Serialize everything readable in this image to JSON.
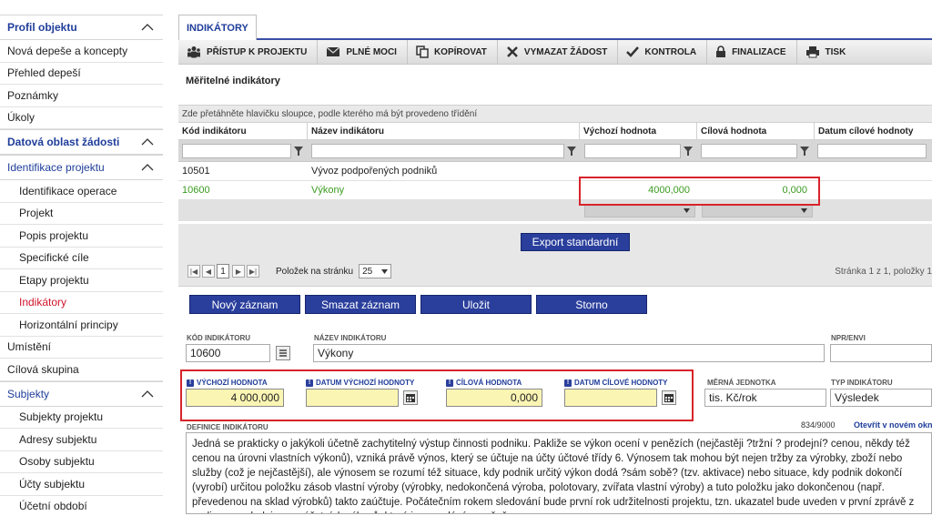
{
  "sidebar": {
    "sections": [
      {
        "title": "Profil objektu",
        "items": [
          "Nová depeše a koncepty",
          "Přehled depeší",
          "Poznámky",
          "Úkoly"
        ]
      },
      {
        "title": "Datová oblast žádosti"
      },
      {
        "title": "Identifikace projektu",
        "items": [
          "Identifikace operace",
          "Projekt",
          "Popis projektu",
          "Specifické cíle",
          "Etapy projektu",
          "Indikátory",
          "Horizontální principy"
        ]
      }
    ],
    "after": [
      "Umístění",
      "Cílová skupina"
    ],
    "subjekty": {
      "title": "Subjekty",
      "items": [
        "Subjekty projektu",
        "Adresy subjektu",
        "Osoby subjektu",
        "Účty subjektu",
        "Účetní období"
      ]
    },
    "active": "Indikátory"
  },
  "tab": "INDIKÁTORY",
  "toolbar": {
    "items": [
      {
        "label": "PŘÍSTUP K PROJEKTU",
        "icon": "users-icon"
      },
      {
        "label": "PLNÉ MOCI",
        "icon": "envelope-icon"
      },
      {
        "label": "KOPÍROVAT",
        "icon": "copy-icon"
      },
      {
        "label": "VYMAZAT ŽÁDOST",
        "icon": "x-icon"
      },
      {
        "label": "KONTROLA",
        "icon": "check-icon"
      },
      {
        "label": "FINALIZACE",
        "icon": "lock-icon"
      },
      {
        "label": "TISK",
        "icon": "printer-icon"
      }
    ]
  },
  "section_title": "Měřitelné indikátory",
  "grid": {
    "drag_hint": "Zde přetáhněte hlavičku sloupce, podle kterého má být provedeno třídění",
    "columns": [
      "Kód indikátoru",
      "Název indikátoru",
      "Výchozí hodnota",
      "Cílová hodnota",
      "Datum cílové hodnoty"
    ],
    "rows": [
      {
        "code": "10501",
        "name": "Vývoz podpořených podniků",
        "start": "",
        "target": ""
      },
      {
        "code": "10600",
        "name": "Výkony",
        "start": "4000,000",
        "target": "0,000"
      }
    ]
  },
  "export_label": "Export standardní",
  "pager": {
    "page": "1",
    "per_page_label": "Položek na stránku",
    "per_page": "25",
    "info": "Stránka 1 z 1, položky 1"
  },
  "actions": {
    "new": "Nový záznam",
    "delete": "Smazat záznam",
    "save": "Uložit",
    "cancel": "Storno"
  },
  "form": {
    "kod_label": "KÓD INDIKÁTORU",
    "kod": "10600",
    "nazev_label": "NÁZEV INDIKÁTORU",
    "nazev": "Výkony",
    "npr_label": "NPR/ENVI",
    "vychozi_label": "VÝCHOZÍ HODNOTA",
    "vychozi": "4 000,000",
    "datum_vych_label": "DATUM VÝCHOZÍ HODNOTY",
    "cilova_label": "CÍLOVÁ HODNOTA",
    "cilova": "0,000",
    "datum_cil_label": "DATUM CÍLOVÉ HODNOTY",
    "jednotka_label": "MĚRNÁ JEDNOTKA",
    "jednotka": "tis. Kč/rok",
    "typ_label": "TYP INDIKÁTORU",
    "typ": "Výsledek",
    "definice_label": "DEFINICE INDIKÁTORU",
    "counter": "834/9000",
    "open_new": "Otevřít v novém okně",
    "definice": "Jedná se prakticky o jakýkoli účetně zachytitelný výstup činnosti podniku. Pakliže se výkon ocení v penězích (nejčastěji ?tržní ? prodejní? cenou, někdy též cenou na úrovni vlastních výkonů), vzniká právě výnos, který se účtuje na účty účtové třídy 6. Výnosem tak mohou být nejen tržby za výrobky, zboží nebo služby (což je nejčastější), ale výnosem se rozumí též situace, kdy podnik určitý výkon dodá ?sám sobě? (tzv. aktivace) nebo situace, kdy podnik dokončí (vyrobí) určitou položku zásob vlastní výroby (výrobky, nedokončená výroba, polotovary, zvířata vlastní výroby) a tuto položku jako dokončenou (např. převedenou na sklad výrobků) takto zaúčtuje. Počátečním rokem sledování bude první rok udržitelnosti projektu, tzn. ukazatel bude uveden v první zprávě z realizace a sleduje se z účetních výkazů, které jsou podávány ročně."
  },
  "colors": {
    "accent": "#2a3f9c",
    "active": "#d0142c",
    "highlight": "#d8232a",
    "green_row": "#3a9b1f",
    "yellow_field": "#fbf5b4"
  }
}
